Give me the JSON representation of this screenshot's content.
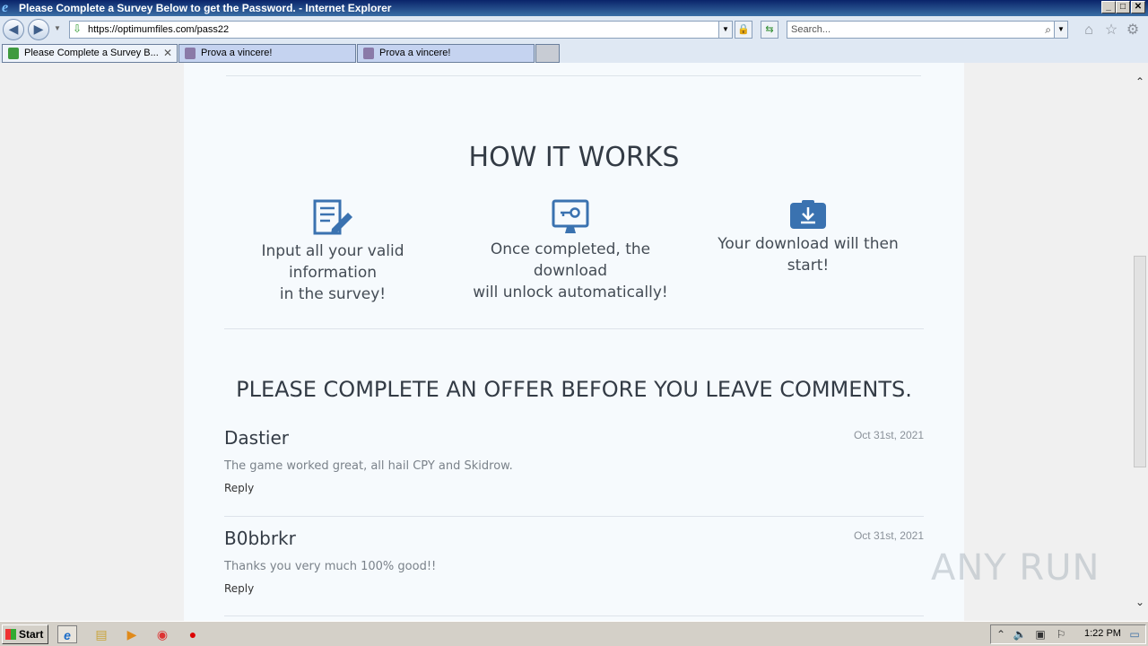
{
  "window": {
    "title": "Please Complete a Survey Below to get the Password. - Internet Explorer"
  },
  "address_bar": {
    "url": "https://optimumfiles.com/pass22"
  },
  "search": {
    "placeholder": "Search..."
  },
  "tabs": [
    {
      "label": "Please Complete a Survey B...",
      "active": true
    },
    {
      "label": "Prova a vincere!",
      "active": false
    },
    {
      "label": "Prova a vincere!",
      "active": false
    }
  ],
  "page": {
    "how_it_works_title": "HOW IT WORKS",
    "steps": [
      {
        "icon": "edit-document-icon",
        "text_line1": "Input all your valid information",
        "text_line2": "in the survey!"
      },
      {
        "icon": "monitor-key-icon",
        "text_line1": "Once completed, the download",
        "text_line2": "will unlock automatically!"
      },
      {
        "icon": "download-box-icon",
        "text_line1": "Your download will then start!",
        "text_line2": ""
      }
    ],
    "comments_title": "PLEASE COMPLETE AN OFFER BEFORE YOU LEAVE COMMENTS.",
    "comments": [
      {
        "name": "Dastier",
        "date": "Oct 31st, 2021",
        "body": "The game worked great, all hail CPY and Skidrow.",
        "reply": "Reply"
      },
      {
        "name": "B0bbrkr",
        "date": "Oct 31st, 2021",
        "body": "Thanks you very much 100% good!!",
        "reply": "Reply"
      }
    ],
    "watermark": "ANY RUN"
  },
  "taskbar": {
    "start_label": "Start",
    "clock": "1:22 PM"
  },
  "colors": {
    "accent_blue": "#3a72b0",
    "page_bg": "#f6fafd",
    "heading": "#333b45"
  }
}
